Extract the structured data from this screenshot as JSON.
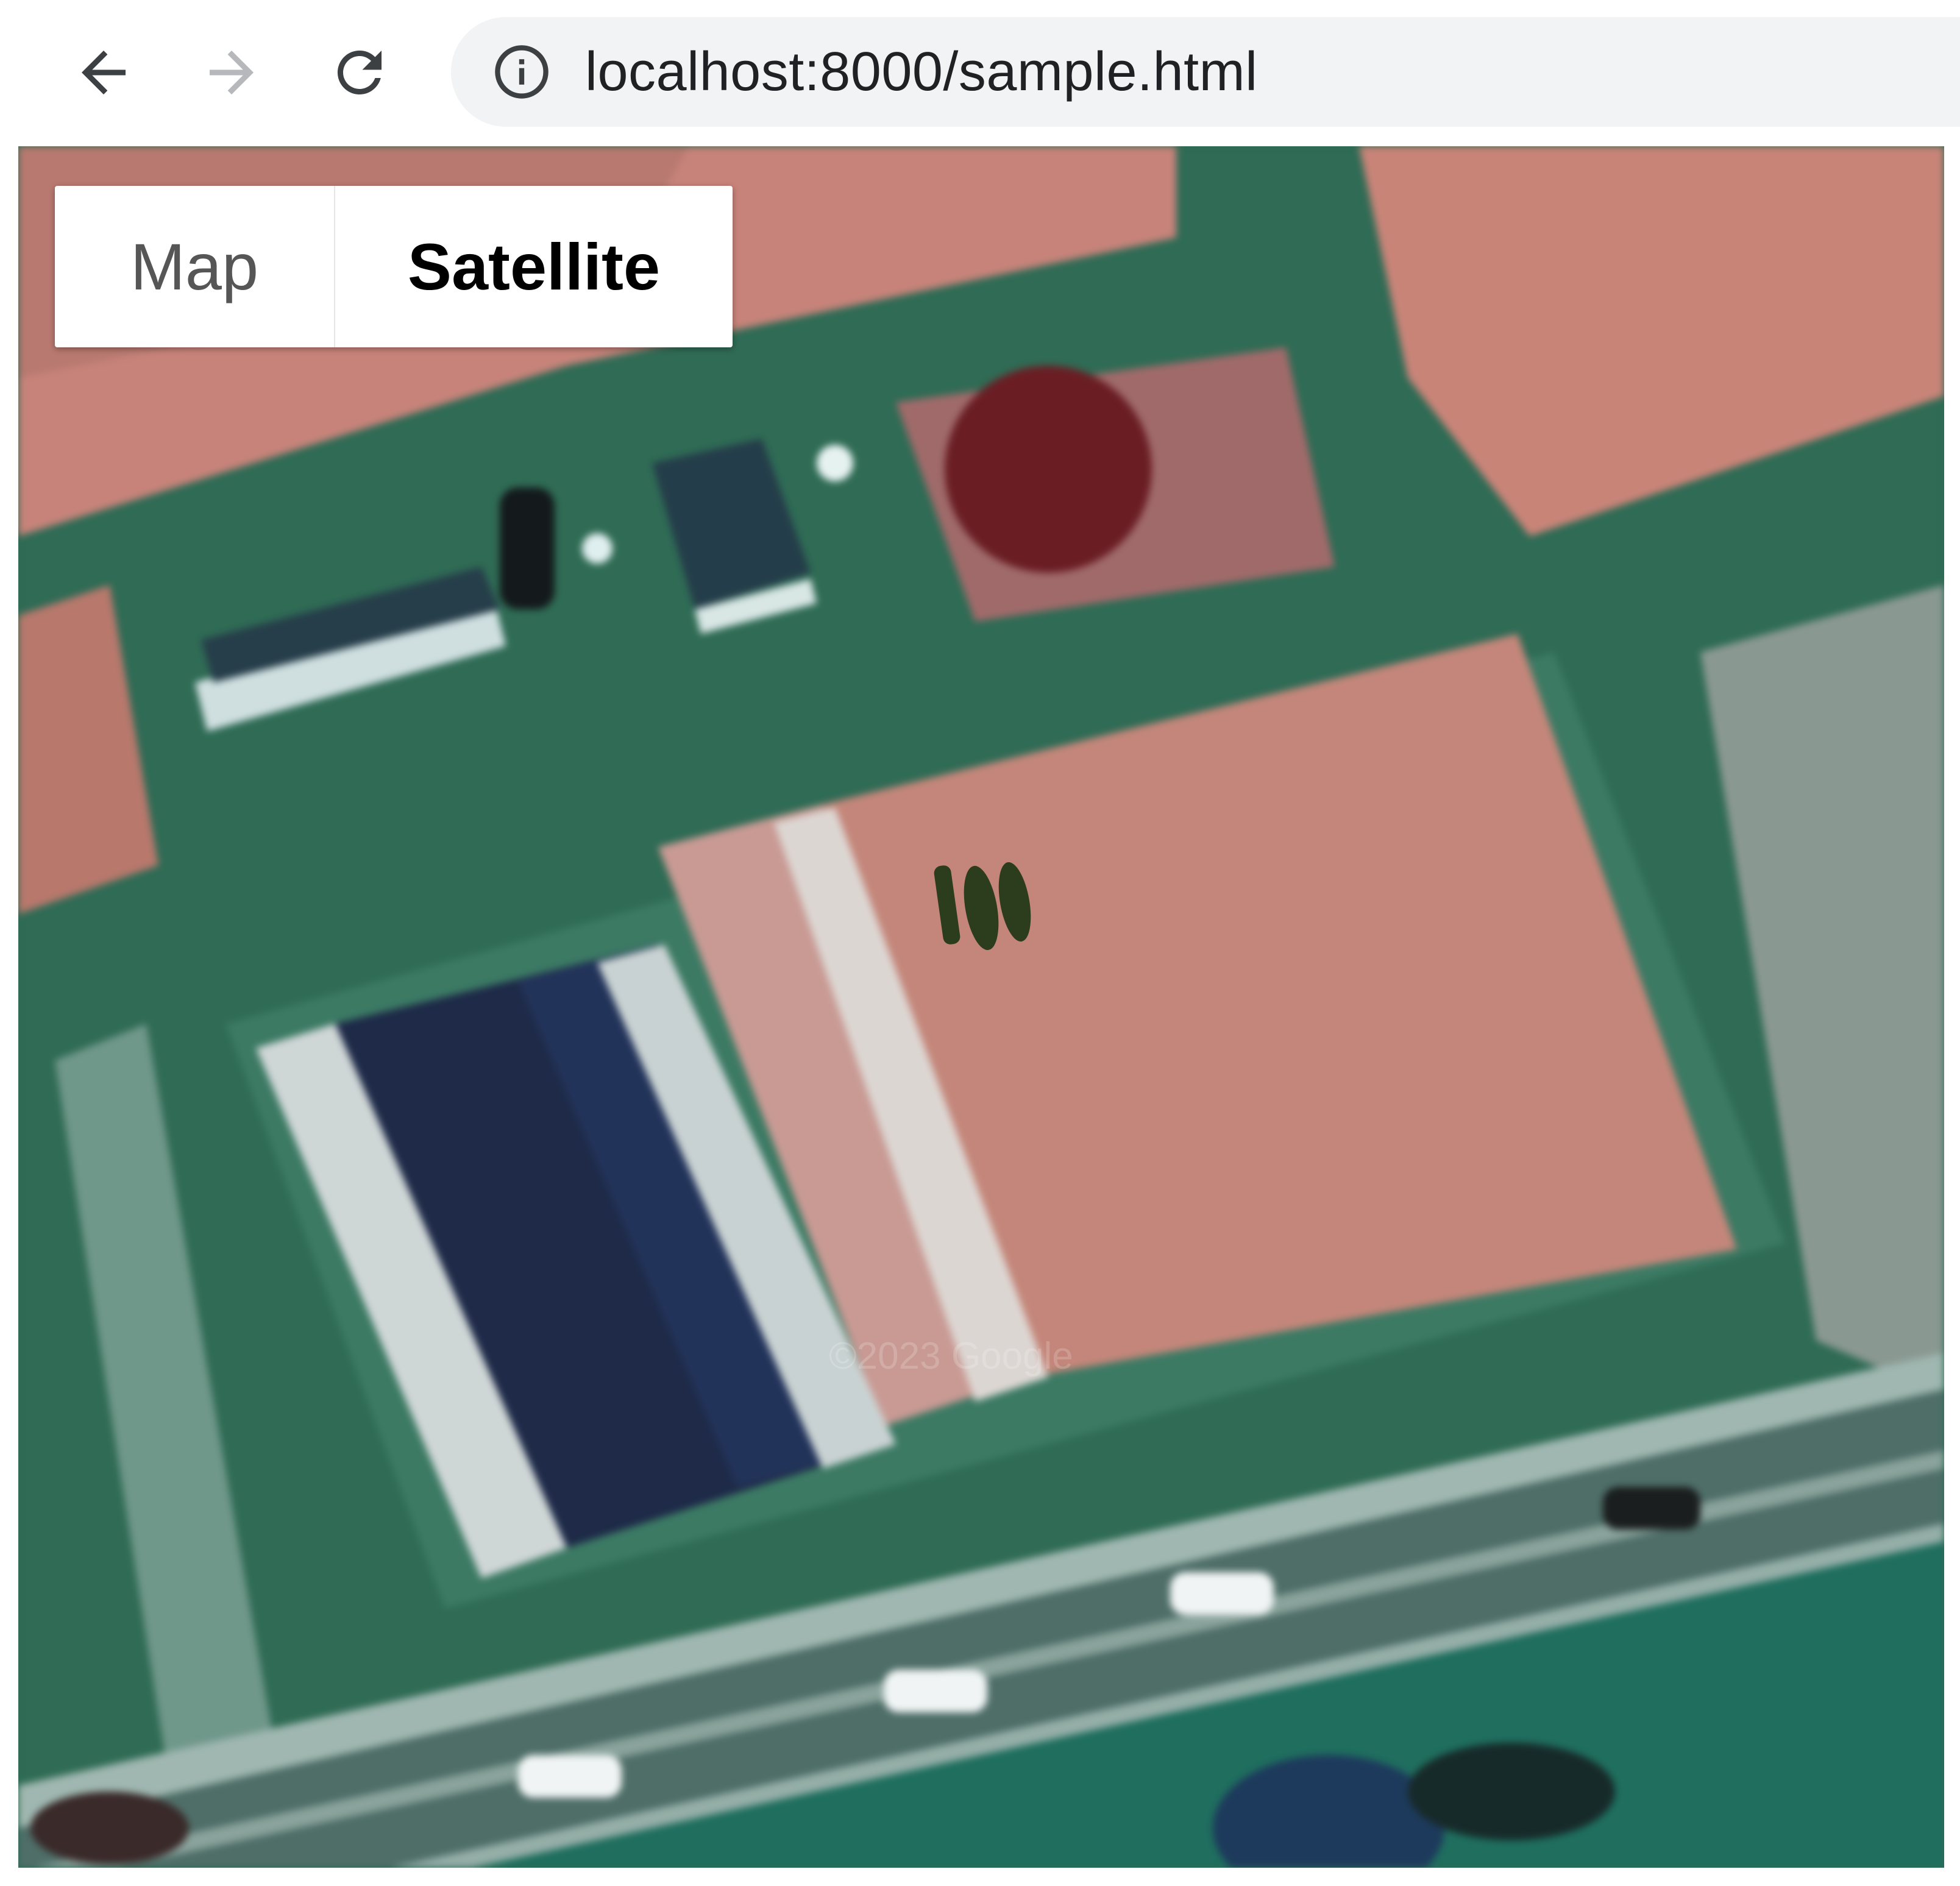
{
  "browser": {
    "url": "localhost:8000/sample.html",
    "icons": {
      "back": "arrow-left-icon",
      "forward": "arrow-right-icon",
      "reload": "reload-icon",
      "info": "info-icon"
    }
  },
  "map": {
    "type_control": {
      "map_label": "Map",
      "satellite_label": "Satellite",
      "selected": "Satellite"
    },
    "imagery_watermark": "©2023 Google",
    "colors": {
      "field_salmon": "#c7837a",
      "grass_teal": "#2f6b55",
      "solar_navy": "#1f2c4a",
      "road_gray": "#7f9b93"
    }
  }
}
